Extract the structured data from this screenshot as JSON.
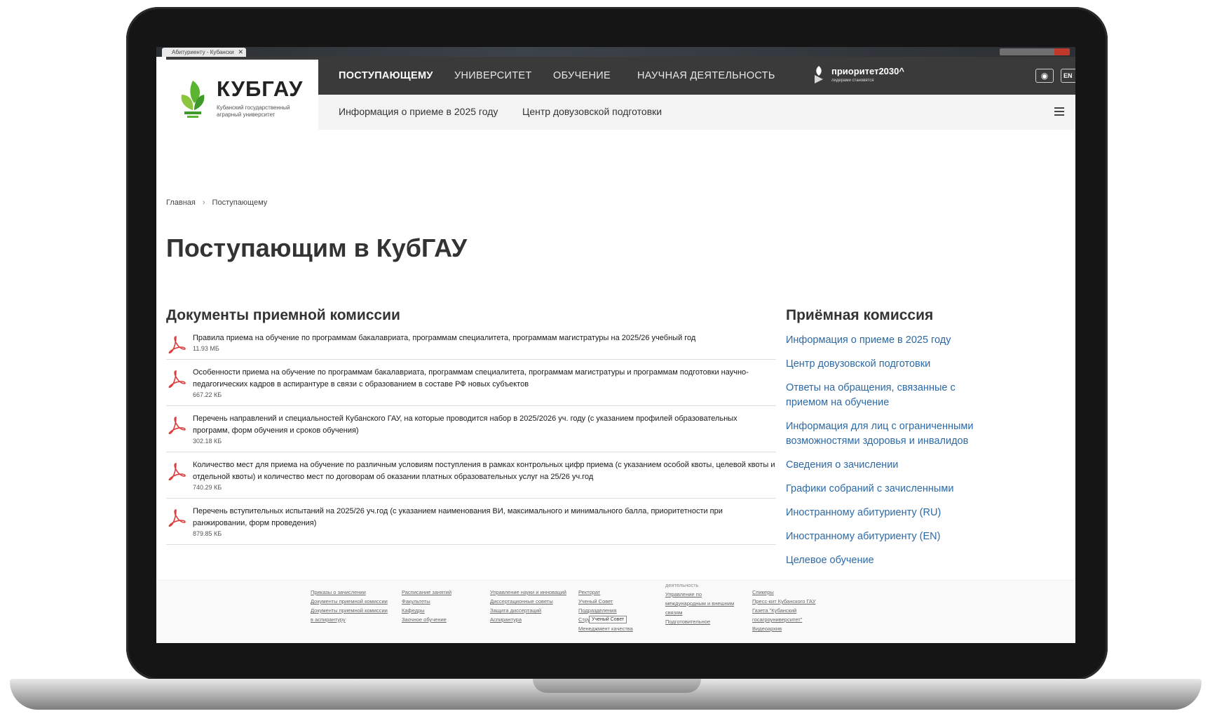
{
  "browser": {
    "tab_title": "Абитуриенту - Кубански",
    "tab_close": "✕"
  },
  "logo": {
    "title": "КУБГАУ",
    "subtitle": "Кубанский государственный аграрный университет"
  },
  "topnav": {
    "items": [
      "ПОСТУПАЮЩЕМУ",
      "УНИВЕРСИТЕТ",
      "ОБУЧЕНИЕ",
      "НАУЧНАЯ ДЕЯТЕЛЬНОСТЬ"
    ],
    "active_index": 0,
    "priority_text": "приоритет2030^",
    "priority_sub": "лидерами становятся",
    "lang_label": "EN"
  },
  "subnav": {
    "items": [
      "Информация о приеме в 2025 году",
      "Центр довузовской подготовки"
    ]
  },
  "breadcrumb": {
    "home": "Главная",
    "separator": "›",
    "current": "Поступающему"
  },
  "page_title": "Поступающим в КубГАУ",
  "documents": {
    "title": "Документы приемной комиссии",
    "items": [
      {
        "name": "Правила приема на обучение по программам бакалавриата, программам специалитета, программам магистратуры на 2025/26 учебный год",
        "size": "11.93 МБ"
      },
      {
        "name": "Особенности приема на обучение по программам бакалавриата, программам специалитета, программам магистратуры и программам подготовки научно-педагогических кадров в аспирантуре в связи с образованием в составе РФ новых субъектов",
        "size": "667.22 КБ"
      },
      {
        "name": "Перечень направлений и специальностей Кубанского ГАУ, на которые проводится набор в 2025/2026 уч. году (с указанием профилей образовательных программ, форм обучения и сроков обучения)",
        "size": "302.18 КБ"
      },
      {
        "name": "Количество мест для приема на обучение по различным условиям поступления в рамках контрольных цифр приема (с указанием особой квоты, целевой квоты и отдельной квоты) и количество мест по договорам об оказании платных образовательных услуг на 25/26 уч.год",
        "size": "740.29 КБ"
      },
      {
        "name": "Перечень вступительных испытаний на 2025/26 уч.год (с указанием наименования ВИ, максимального и минимального балла, приоритетности при ранжировании, форм проведения)",
        "size": "879.85 КБ"
      }
    ]
  },
  "sidebar": {
    "title": "Приёмная комиссия",
    "links": [
      "Информация о приеме в 2025 году",
      "Центр довузовской подготовки",
      "Ответы на обращения, связанные с приемом на обучение",
      "Информация для лиц с ограниченными возможностями здоровья и инвалидов",
      "Сведения о зачислении",
      "Графики собраний с зачисленными",
      "Иностранному абитуриенту (RU)",
      "Иностранному абитуриенту (EN)",
      "Целевое обучение"
    ]
  },
  "footer": {
    "columns": [
      {
        "heading": "",
        "links": [
          "Приказы о зачислении",
          "Документы приемной комиссии",
          "Документы приемной комиссии в аспирантуру"
        ]
      },
      {
        "heading": "",
        "links": [
          "Расписание занятий",
          "Факультеты",
          "Кафедры",
          "Заочное обучение"
        ]
      },
      {
        "heading": "",
        "links": [
          "Управление науки и инноваций",
          "Диссертационные советы",
          "Защита диссертаций",
          "Аспирантура"
        ]
      },
      {
        "heading": "",
        "links": [
          "Ректорат",
          "Ученый Совет",
          "Подразделения",
          "Структура",
          "Менеджмент качества"
        ]
      },
      {
        "heading": "деятельность",
        "links": [
          "Управление по международным и внешним связям",
          "Подготовительное"
        ]
      },
      {
        "heading": "",
        "links": [
          "Спикеры",
          "Пресс-кит Кубанского ГАУ",
          "Газета \"Кубанский госагроуниверситет\"",
          "Видеоархив"
        ]
      }
    ],
    "tooltip": "Ученый Совет"
  },
  "colors": {
    "nav_bg": "#3a3a3a",
    "link": "#2c6aa7",
    "pdf_icon": "#e03b3b",
    "logo_green": "#5bb531"
  }
}
